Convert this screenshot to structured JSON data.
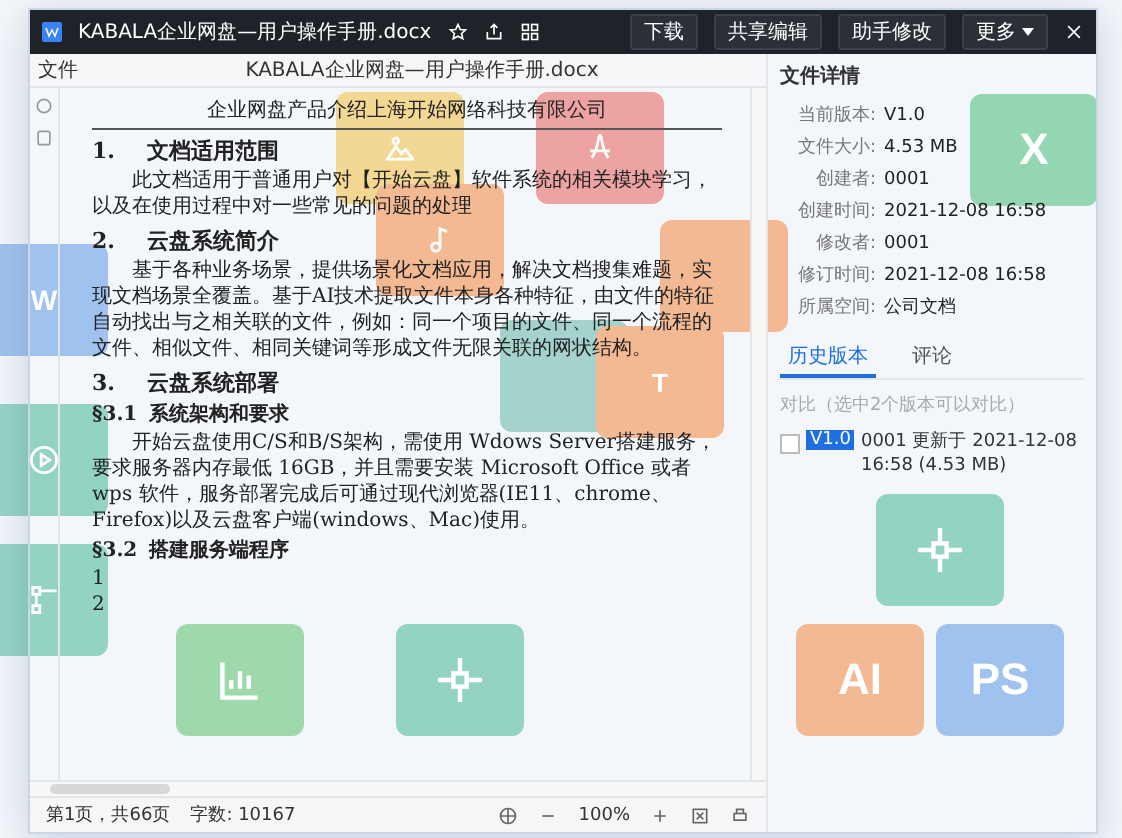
{
  "window": {
    "title": "KABALA企业网盘—用户操作手册.docx",
    "actions": [
      {
        "label": "下载"
      },
      {
        "label": "共享编辑"
      },
      {
        "label": "助手修改"
      }
    ],
    "more": "更多"
  },
  "subheader": {
    "menu": "文件",
    "filename": "KABALA企业网盘—用户操作手册.docx"
  },
  "document": {
    "header": "企业网盘产品介绍上海开始网络科技有限公司",
    "blocks": [
      {
        "kind": "heading",
        "number": "1.",
        "text": "文档适用范围"
      },
      {
        "kind": "paragraph",
        "text": "此文档适用于普通用户对【开始云盘】软件系统的相关模块学习，以及在使用过程中对一些常见的问题的处理"
      },
      {
        "kind": "heading",
        "number": "2.",
        "text": "云盘系统简介"
      },
      {
        "kind": "paragraph",
        "text": "基于各种业务场景，提供场景化文档应用，解决文档搜集难题，实现文档场景全覆盖。基于AI技术提取文件本身各种特征，由文件的特征自动找出与之相关联的文件，例如：同一个项目的文件、同一个流程的文件、相似文件、相同关键词等形成文件无限关联的网状结构。"
      },
      {
        "kind": "heading",
        "number": "3.",
        "text": "云盘系统部署"
      },
      {
        "kind": "subheading",
        "number": "§3.1",
        "text": "系统架构和要求"
      },
      {
        "kind": "paragraph",
        "text": "开始云盘使用C/S和B/S架构，需使用 Wdows Server搭建服务，要求服务器内存最低 16GB，并且需要安装 Microsoft Office 或者 wps 软件，服务部署完成后可通过现代浏览器(IE11、chrome、Firefox)以及云盘客户端(windows、Mac)使用。"
      },
      {
        "kind": "subheading",
        "number": "§3.2",
        "text": "搭建服务端程序"
      },
      {
        "kind": "list_item",
        "number": "1"
      },
      {
        "kind": "list_item",
        "number": "2"
      }
    ]
  },
  "details": {
    "title": "文件详情",
    "fields": [
      {
        "label": "当前版本:",
        "value": "V1.0"
      },
      {
        "label": "文件大小:",
        "value": "4.53 MB"
      },
      {
        "label": "创建者:",
        "value": "0001"
      },
      {
        "label": "创建时间:",
        "value": "2021-12-08 16:58"
      },
      {
        "label": "修改者:",
        "value": "0001"
      },
      {
        "label": "修订时间:",
        "value": "2021-12-08 16:58"
      },
      {
        "label": "所属空间:",
        "value": "公司文档"
      }
    ],
    "tabs": [
      {
        "label": "历史版本",
        "selected": true
      },
      {
        "label": "评论",
        "selected": false
      }
    ],
    "compare": "对比（选中2个版本可以对比）",
    "versions": [
      {
        "badge": "V1.0",
        "text": "0001 更新于 2021-12-08 16:58 (4.53 MB)",
        "checked": false
      }
    ]
  },
  "status_bar": {
    "page": "第1页，共66页",
    "words": "字数: 10167",
    "zoom": "100%"
  },
  "tiles": [
    {
      "kind": "letter",
      "label": "W",
      "color": "#9fc2ee"
    },
    {
      "kind": "image",
      "color": "#f3d894"
    },
    {
      "kind": "pdf",
      "color": "#eea3a3"
    },
    {
      "kind": "blank",
      "color": "#f3b993"
    },
    {
      "kind": "letter",
      "label": "X",
      "color": "#93d6b1"
    },
    {
      "kind": "play",
      "color": "#93d3c3"
    },
    {
      "kind": "music",
      "color": "#f3b993"
    },
    {
      "kind": "blank",
      "color": "#a3d3cc"
    },
    {
      "kind": "letter",
      "label": "T",
      "color": "#f3b993"
    },
    {
      "kind": "cross",
      "color": "#93d3c3"
    },
    {
      "kind": "flow",
      "color": "#93d3c3"
    },
    {
      "kind": "chart",
      "color": "#9fd8aa"
    },
    {
      "kind": "cross",
      "color": "#93d3c3"
    },
    {
      "kind": "letter",
      "label": "AI",
      "color": "#f3b993"
    },
    {
      "kind": "letter",
      "label": "PS",
      "color": "#9fc2ee"
    }
  ]
}
